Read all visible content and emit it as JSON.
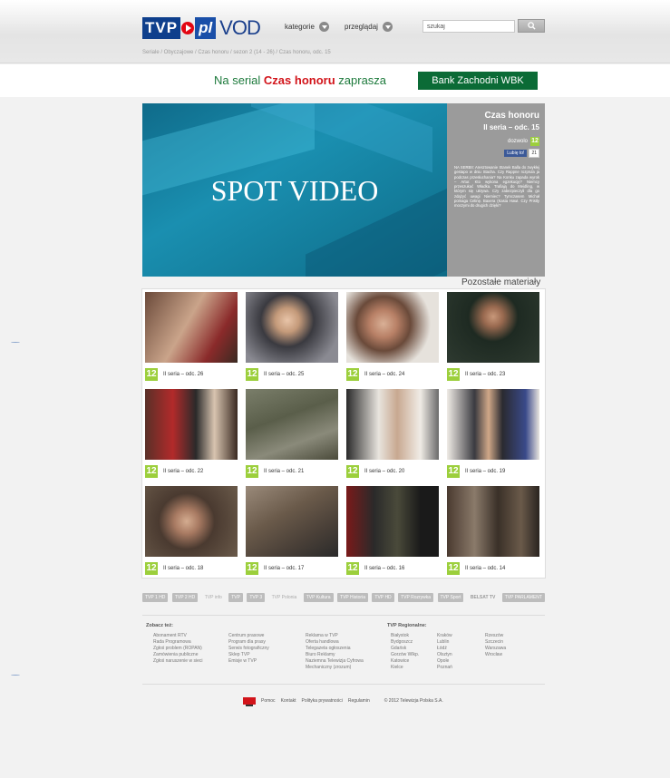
{
  "header": {
    "logo": {
      "tvp": "TVP",
      "pl": "pl",
      "vod": "VOD"
    },
    "nav": [
      {
        "label": "kategorie"
      },
      {
        "label": "przeglądaj"
      }
    ],
    "search_value": "szukaj",
    "breadcrumb": "Seriale / Obyczajowe / Czas honoru / sezon 2 (14 - 26) / Czas honoru, odc. 15"
  },
  "sponsor": {
    "prefix": "Na serial",
    "title": "Czas honoru",
    "suffix": "zaprasza",
    "bank": "Bank Zachodni WBK"
  },
  "player": {
    "overlay_text": "SPOT VIDEO"
  },
  "info": {
    "title": "Czas honoru",
    "episode": "II seria – odc. 15",
    "age_label": "dozwolo",
    "age": "12",
    "fb_like": "Lubię to!",
    "fb_count": "21",
    "description": "NA SERBII: Aresztowanie Stanek Balla do zwykłej gestapo w dniu Stacha. Czy Rappne rozprula ja podczas przesłuchania? Na Konku zapada wyrok – Artur. Kto wykona egzekucję? Niemcy przeszukać Władka. Trafiają do Meidling, w którym się ukrywa. Czy zabezpieczyli dla go zdążyć uwagi Niemiec? Tymczasem Michał pomaga Celinę. Baxera (Kasia Hawi. Czy Pristly moczymi do drugich dzięki?"
  },
  "more_title": "Pozostałe materiały",
  "materials": [
    {
      "label": "II seria – odc. 26",
      "age": "12"
    },
    {
      "label": "II seria – odc. 25",
      "age": "12"
    },
    {
      "label": "II seria – odc. 24",
      "age": "12"
    },
    {
      "label": "II seria – odc. 23",
      "age": "12"
    },
    {
      "label": "II seria – odc. 22",
      "age": "12"
    },
    {
      "label": "II seria – odc. 21",
      "age": "12"
    },
    {
      "label": "II seria – odc. 20",
      "age": "12"
    },
    {
      "label": "II seria – odc. 19",
      "age": "12"
    },
    {
      "label": "II seria – odc. 18",
      "age": "12"
    },
    {
      "label": "II seria – odc. 17",
      "age": "12"
    },
    {
      "label": "II seria – odc. 16",
      "age": "12"
    },
    {
      "label": "II seria – odc. 14",
      "age": "12"
    }
  ],
  "channels": [
    "TVP 1 HD",
    "TVP 2 HD",
    "TVP info",
    "TVP",
    "TVP 3",
    "TVP Polonia",
    "TVP Kultura",
    "TVP Historia",
    "TVP HD",
    "TVP Rozrywka",
    "TVP Sport",
    "BELSAT TV",
    "TVP PARLAMENT"
  ],
  "footer": {
    "see_also": "Zobacz też:",
    "regional": "TVP Regionalne:",
    "col1": [
      "Abonament RTV",
      "Rada Programowa",
      "Zgłoś problem (ROPAN)",
      "Zamówienia publiczne",
      "Zgłoś naruszenie w sieci"
    ],
    "col2": [
      "Centrum prasowe",
      "Program dla prasy",
      "Serwis fotograficzny",
      "Sklep TVP",
      "Emisje w TVP"
    ],
    "col3": [
      "Reklama w TVP",
      "Oferta handlowa",
      "Telegazeta ogłoszenia",
      "Biuro Reklamy",
      "Naziemna Telewizja Cyfrowa",
      "Mechaniczny (zrozum)"
    ],
    "col4": [
      "Białystok",
      "Bydgoszcz",
      "Gdańsk",
      "Gorzów Wlkp.",
      "Katowice",
      "Kielce"
    ],
    "col5": [
      "Kraków",
      "Lublin",
      "Łódź",
      "Olsztyn",
      "Opole",
      "Poznań"
    ],
    "col6": [
      "Rzeszów",
      "Szczecin",
      "Warszawa",
      "Wrocław"
    ],
    "bottom_links": [
      "Pomoc",
      "Kontakt",
      "Polityka prywatności",
      "Regulamin"
    ],
    "copyright": "© 2012 Telewizja Polska S.A."
  }
}
